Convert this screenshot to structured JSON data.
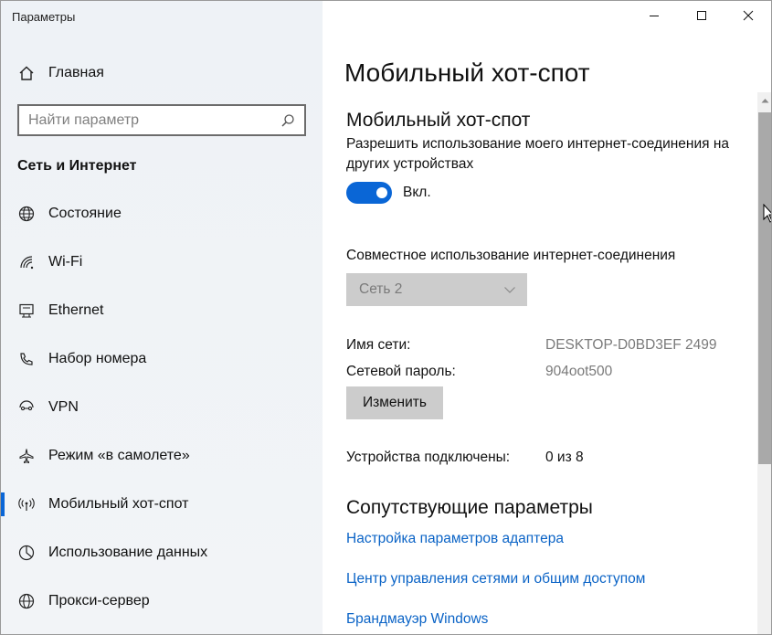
{
  "window": {
    "title": "Параметры"
  },
  "sidebar": {
    "home_label": "Главная",
    "search_placeholder": "Найти параметр",
    "section_title": "Сеть и Интернет",
    "items": [
      {
        "label": "Состояние",
        "icon": "globe-icon"
      },
      {
        "label": "Wi-Fi",
        "icon": "wifi-icon"
      },
      {
        "label": "Ethernet",
        "icon": "ethernet-icon"
      },
      {
        "label": "Набор номера",
        "icon": "dialup-icon"
      },
      {
        "label": "VPN",
        "icon": "vpn-icon"
      },
      {
        "label": "Режим «в самолете»",
        "icon": "airplane-icon"
      },
      {
        "label": "Мобильный хот-спот",
        "icon": "hotspot-icon",
        "active": true
      },
      {
        "label": "Использование данных",
        "icon": "data-usage-icon"
      },
      {
        "label": "Прокси-сервер",
        "icon": "globe-icon"
      }
    ]
  },
  "main": {
    "page_title": "Мобильный хот-спот",
    "section_title": "Мобильный хот-спот",
    "description": "Разрешить использование моего интернет-соединения на других устройствах",
    "toggle": {
      "on": true,
      "label": "Вкл."
    },
    "share_label": "Совместное использование интернет-соединения",
    "share_dropdown_value": "Сеть 2",
    "network_name_label": "Имя сети:",
    "network_name_value": "DESKTOP-D0BD3EF 2499",
    "password_label": "Сетевой пароль:",
    "password_value": "904oot500",
    "edit_button": "Изменить",
    "devices_label": "Устройства подключены:",
    "devices_value": "0 из 8",
    "related_title": "Сопутствующие параметры",
    "links": [
      "Настройка параметров адаптера",
      "Центр управления сетями и общим доступом",
      "Брандмауэр Windows"
    ]
  },
  "colors": {
    "accent": "#0a66d6",
    "link": "#0a63c6",
    "sidebar_bg": "#eef2f6",
    "disabled_bg": "#cccccc"
  }
}
